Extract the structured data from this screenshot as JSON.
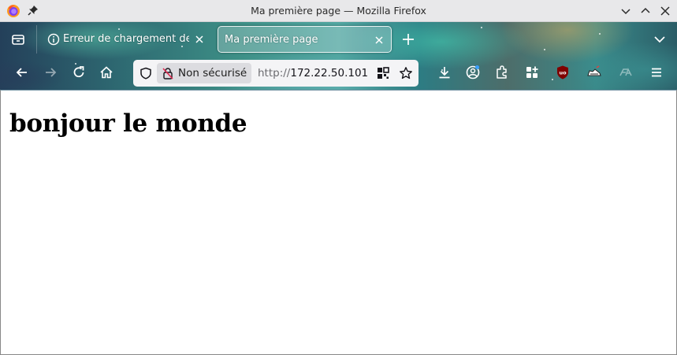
{
  "window": {
    "title": "Ma première page — Mozilla Firefox"
  },
  "tabs": [
    {
      "label": "Erreur de chargement de la page",
      "active": false,
      "icon": "info-icon"
    },
    {
      "label": "Ma première page",
      "active": true
    }
  ],
  "navbar": {
    "identity_label": "Non sécurisé",
    "url_scheme": "http://",
    "url_host": "172.22.50.101"
  },
  "extensions": [
    "download-icon",
    "account-icon",
    "extensions-icon",
    "extension-grid-icon",
    "ublock-icon",
    "extension-sneaker-icon",
    "extension-ea-icon",
    "menu-icon"
  ],
  "colors": {
    "identity_bg": "#dcdce0",
    "urlbar_bg": "#f4f4f6",
    "ublock_red": "#800000"
  },
  "page": {
    "heading": "bonjour le monde"
  }
}
